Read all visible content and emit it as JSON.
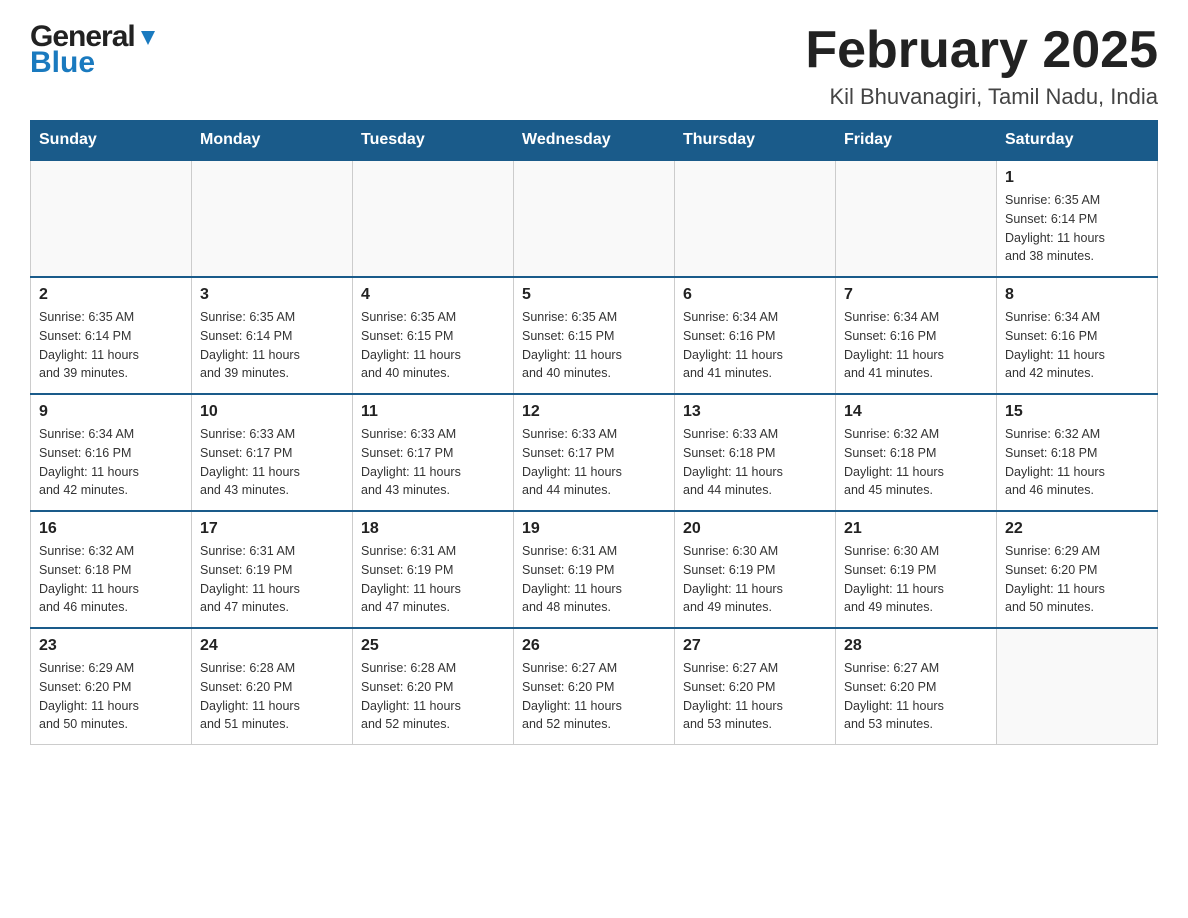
{
  "header": {
    "logo_general": "General",
    "logo_blue": "Blue",
    "month_title": "February 2025",
    "location": "Kil Bhuvanagiri, Tamil Nadu, India"
  },
  "days_of_week": [
    "Sunday",
    "Monday",
    "Tuesday",
    "Wednesday",
    "Thursday",
    "Friday",
    "Saturday"
  ],
  "weeks": [
    [
      {
        "day": "",
        "info": ""
      },
      {
        "day": "",
        "info": ""
      },
      {
        "day": "",
        "info": ""
      },
      {
        "day": "",
        "info": ""
      },
      {
        "day": "",
        "info": ""
      },
      {
        "day": "",
        "info": ""
      },
      {
        "day": "1",
        "info": "Sunrise: 6:35 AM\nSunset: 6:14 PM\nDaylight: 11 hours\nand 38 minutes."
      }
    ],
    [
      {
        "day": "2",
        "info": "Sunrise: 6:35 AM\nSunset: 6:14 PM\nDaylight: 11 hours\nand 39 minutes."
      },
      {
        "day": "3",
        "info": "Sunrise: 6:35 AM\nSunset: 6:14 PM\nDaylight: 11 hours\nand 39 minutes."
      },
      {
        "day": "4",
        "info": "Sunrise: 6:35 AM\nSunset: 6:15 PM\nDaylight: 11 hours\nand 40 minutes."
      },
      {
        "day": "5",
        "info": "Sunrise: 6:35 AM\nSunset: 6:15 PM\nDaylight: 11 hours\nand 40 minutes."
      },
      {
        "day": "6",
        "info": "Sunrise: 6:34 AM\nSunset: 6:16 PM\nDaylight: 11 hours\nand 41 minutes."
      },
      {
        "day": "7",
        "info": "Sunrise: 6:34 AM\nSunset: 6:16 PM\nDaylight: 11 hours\nand 41 minutes."
      },
      {
        "day": "8",
        "info": "Sunrise: 6:34 AM\nSunset: 6:16 PM\nDaylight: 11 hours\nand 42 minutes."
      }
    ],
    [
      {
        "day": "9",
        "info": "Sunrise: 6:34 AM\nSunset: 6:16 PM\nDaylight: 11 hours\nand 42 minutes."
      },
      {
        "day": "10",
        "info": "Sunrise: 6:33 AM\nSunset: 6:17 PM\nDaylight: 11 hours\nand 43 minutes."
      },
      {
        "day": "11",
        "info": "Sunrise: 6:33 AM\nSunset: 6:17 PM\nDaylight: 11 hours\nand 43 minutes."
      },
      {
        "day": "12",
        "info": "Sunrise: 6:33 AM\nSunset: 6:17 PM\nDaylight: 11 hours\nand 44 minutes."
      },
      {
        "day": "13",
        "info": "Sunrise: 6:33 AM\nSunset: 6:18 PM\nDaylight: 11 hours\nand 44 minutes."
      },
      {
        "day": "14",
        "info": "Sunrise: 6:32 AM\nSunset: 6:18 PM\nDaylight: 11 hours\nand 45 minutes."
      },
      {
        "day": "15",
        "info": "Sunrise: 6:32 AM\nSunset: 6:18 PM\nDaylight: 11 hours\nand 46 minutes."
      }
    ],
    [
      {
        "day": "16",
        "info": "Sunrise: 6:32 AM\nSunset: 6:18 PM\nDaylight: 11 hours\nand 46 minutes."
      },
      {
        "day": "17",
        "info": "Sunrise: 6:31 AM\nSunset: 6:19 PM\nDaylight: 11 hours\nand 47 minutes."
      },
      {
        "day": "18",
        "info": "Sunrise: 6:31 AM\nSunset: 6:19 PM\nDaylight: 11 hours\nand 47 minutes."
      },
      {
        "day": "19",
        "info": "Sunrise: 6:31 AM\nSunset: 6:19 PM\nDaylight: 11 hours\nand 48 minutes."
      },
      {
        "day": "20",
        "info": "Sunrise: 6:30 AM\nSunset: 6:19 PM\nDaylight: 11 hours\nand 49 minutes."
      },
      {
        "day": "21",
        "info": "Sunrise: 6:30 AM\nSunset: 6:19 PM\nDaylight: 11 hours\nand 49 minutes."
      },
      {
        "day": "22",
        "info": "Sunrise: 6:29 AM\nSunset: 6:20 PM\nDaylight: 11 hours\nand 50 minutes."
      }
    ],
    [
      {
        "day": "23",
        "info": "Sunrise: 6:29 AM\nSunset: 6:20 PM\nDaylight: 11 hours\nand 50 minutes."
      },
      {
        "day": "24",
        "info": "Sunrise: 6:28 AM\nSunset: 6:20 PM\nDaylight: 11 hours\nand 51 minutes."
      },
      {
        "day": "25",
        "info": "Sunrise: 6:28 AM\nSunset: 6:20 PM\nDaylight: 11 hours\nand 52 minutes."
      },
      {
        "day": "26",
        "info": "Sunrise: 6:27 AM\nSunset: 6:20 PM\nDaylight: 11 hours\nand 52 minutes."
      },
      {
        "day": "27",
        "info": "Sunrise: 6:27 AM\nSunset: 6:20 PM\nDaylight: 11 hours\nand 53 minutes."
      },
      {
        "day": "28",
        "info": "Sunrise: 6:27 AM\nSunset: 6:20 PM\nDaylight: 11 hours\nand 53 minutes."
      },
      {
        "day": "",
        "info": ""
      }
    ]
  ]
}
